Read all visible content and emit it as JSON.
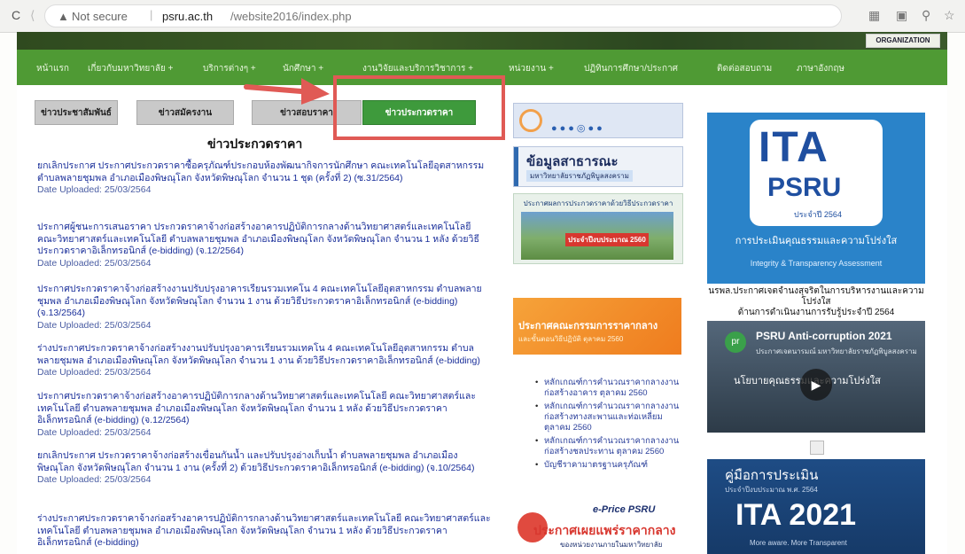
{
  "browser": {
    "secure_label": "Not secure",
    "url_host": "psru.ac.th",
    "url_path": "/website2016/index.php"
  },
  "banner": {
    "logo_text": "ORGANIZATION"
  },
  "nav": {
    "items": [
      "หน้าแรก",
      "เกี่ยวกับมหาวิทยาลัย +",
      "บริการต่างๆ +",
      "นักศึกษา +",
      "งานวิจัยและบริการวิชาการ +",
      "หน่วยงาน +",
      "ปฏิทินการศึกษา/ประกาศ",
      "ติดต่อสอบถาม",
      "ภาษาอังกฤษ"
    ]
  },
  "tabs": [
    {
      "label": "ข่าวประชาสัมพันธ์",
      "active": false
    },
    {
      "label": "ข่าวสมัครงาน",
      "active": false
    },
    {
      "label": "ข่าวสอบราคา",
      "active": false
    },
    {
      "label": "ข่าวประกวดราคา",
      "active": true
    }
  ],
  "list_title": "ข่าวประกวดราคา",
  "entries": [
    {
      "text": "ยกเลิกประกาศ ประกาศประกวดราคาซื้อครุภัณฑ์ประกอบห้องพัฒนากิจการนักศึกษา คณะเทคโนโลยีอุตสาหกรรม ตำบลพลายชุมพล อำเภอเมืองพิษณุโลก จังหวัดพิษณุโลก จำนวน 1 ชุด (ครั้งที่ 2) (ซ.31/2564)",
      "date": "Date Uploaded: 25/03/2564"
    },
    {
      "text": "ประกาศผู้ชนะการเสนอราคา ประกวดราคาจ้างก่อสร้างอาคารปฏิบัติการกลางด้านวิทยาศาสตร์และเทคโนโลยี คณะวิทยาศาสตร์และเทคโนโลยี ตำบลพลายชุมพล อำเภอเมืองพิษณุโลก จังหวัดพิษณุโลก จำนวน 1 หลัง ด้วยวิธีประกวดราคาอิเล็กทรอนิกส์ (e-bidding) (จ.12/2564)",
      "date": "Date Uploaded: 25/03/2564"
    },
    {
      "text": "ประกาศประกวดราคาจ้างก่อสร้างงานปรับปรุงอาคารเรียนรวมเทคโน 4 คณะเทคโนโลยีอุตสาหกรรม ตำบลพลายชุมพล อำเภอเมืองพิษณุโลก จังหวัดพิษณุโลก จำนวน 1 งาน ด้วยวิธีประกวดราคาอิเล็กทรอนิกส์ (e-bidding) (จ.13/2564)",
      "date": "Date Uploaded: 25/03/2564"
    },
    {
      "text": "ร่างประกาศประกวดราคาจ้างก่อสร้างงานปรับปรุงอาคารเรียนรวมเทคโน 4 คณะเทคโนโลยีอุตสาหกรรม ตำบลพลายชุมพล อำเภอเมืองพิษณุโลก จังหวัดพิษณุโลก จำนวน 1 งาน ด้วยวิธีประกวดราคาอิเล็กทรอนิกส์ (e-bidding)",
      "date": "Date Uploaded: 25/03/2564"
    },
    {
      "text": "ประกาศประกวดราคาจ้างก่อสร้างอาคารปฏิบัติการกลางด้านวิทยาศาสตร์และเทคโนโลยี คณะวิทยาศาสตร์และเทคโนโลยี ตำบลพลายชุมพล อำเภอเมืองพิษณุโลก จังหวัดพิษณุโลก จำนวน 1 หลัง ด้วยวิธีประกวดราคาอิเล็กทรอนิกส์ (e-bidding) (จ.12/2564)",
      "date": "Date Uploaded: 25/03/2564"
    },
    {
      "text": "ยกเลิกประกาศ ประกวดราคาจ้างก่อสร้างเขื่อนกันน้ำ และปรับปรุงอ่างเก็บน้ำ ตำบลพลายชุมพล อำเภอเมืองพิษณุโลก จังหวัดพิษณุโลก จำนวน 1 งาน (ครั้งที่ 2) ด้วยวิธีประกวดราคาอิเล็กทรอนิกส์ (e-bidding) (จ.10/2564)",
      "date": "Date Uploaded: 25/03/2564"
    },
    {
      "text": "ร่างประกาศประกวดราคาจ้างก่อสร้างอาคารปฏิบัติการกลางด้านวิทยาศาสตร์และเทคโนโลยี คณะวิทยาศาสตร์และเทคโนโลยี ตำบลพลายชุมพล อำเภอเมืองพิษณุโลก จังหวัดพิษณุโลก จำนวน 1 หลัง ด้วยวิธีประกวดราคาอิเล็กทรอนิกส์ (e-bidding)",
      "date": ""
    }
  ],
  "mid": {
    "public_info": "ข้อมูลสาธารณะ",
    "public_info_sub": "มหาวิทยาลัยราชภัฏพิบูลสงคราม",
    "bidding_head": "ประกาศผลการประกวดราคาด้วยวิธีประกวดราคา",
    "budget_line": "ประจำปีงบประมาณ 2560",
    "orange_title": "ประกาศคณะกรรมการราคากลาง",
    "orange_sub": "และขั้นตอนวิธีปฏิบัติ ตุลาคม 2560",
    "bullets": [
      "หลักเกณฑ์การคำนวณราคากลางงานก่อสร้างอาคาร ตุลาคม 2560",
      "หลักเกณฑ์การคำนวณราคากลางงานก่อสร้างทางสะพานและท่อเหลี่ยม ตุลาคม 2560",
      "หลักเกณฑ์การคำนวณราคากลางงานก่อสร้างชลประทาน ตุลาคม 2560",
      "บัญชีราคามาตรฐานครุภัณฑ์"
    ],
    "eprice_label": "e-Price PSRU",
    "eprice_title": "ประกาศเผยแพร่ราคากลาง",
    "eprice_sub": "ของหน่วยงานภายในมหาวิทยาลัย"
  },
  "right": {
    "ita_logo": "ITA",
    "psru": "PSRU",
    "ita_year": "ประจำปี 2564",
    "ita_caption": "การประเมินคุณธรรมและความโปร่งใส",
    "ita_caption_en": "Integrity & Transparency Assessment",
    "notice_1": "นรพล.ประกาศเจตจำนงสุจริตในการบริหารงานและความโปร่งใส",
    "notice_2": "ด้านการดำเนินงานการรับรู้ประจำปี 2564",
    "video_title": "PSRU Anti-corruption 2021",
    "video_sub": "ประกาศเจตนารมณ์ มหาวิทยาลัยราชภัฏพิบูลสงคราม",
    "video_caption": "นโยบายคุณธรรมและความโปร่งใส",
    "manual_label": "คู่มือการประเมิน",
    "manual_sub": "ประจำปีงบประมาณ พ.ศ. 2564",
    "ita2021": "ITA 2021",
    "manual_tagline": "More aware. More Transparent"
  }
}
